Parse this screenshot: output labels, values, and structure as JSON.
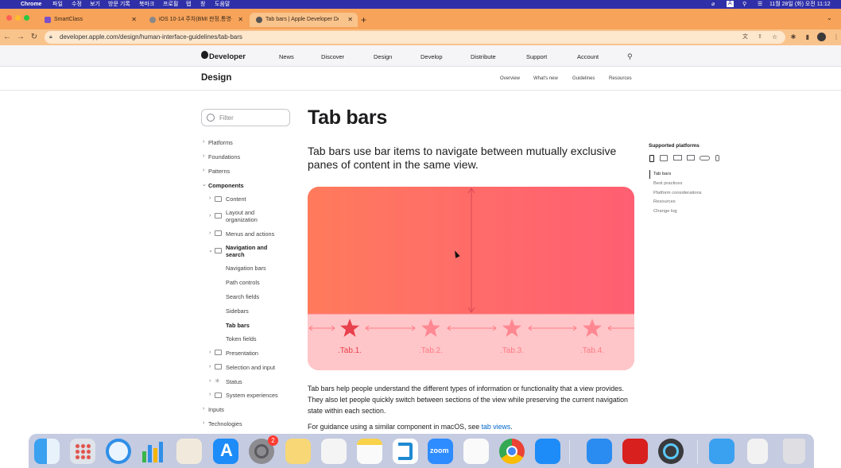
{
  "menubar": {
    "app": "Chrome",
    "items": [
      "파일",
      "수정",
      "보기",
      "방문 기록",
      "북마크",
      "프로필",
      "탭",
      "창",
      "도움말"
    ],
    "clock": "11월 28일 (화) 오전 11:12"
  },
  "browser": {
    "tabs": [
      {
        "title": "SmartClass",
        "active": false,
        "favicon_color": "#7b4fc8"
      },
      {
        "title": "iOS 10-14 주차(BMI 판정,통영신...",
        "active": false,
        "favicon_color": "#888888"
      },
      {
        "title": "Tab bars | Apple Developer Do...",
        "active": true,
        "favicon_color": "#555555"
      }
    ],
    "url": "developer.apple.com/design/human-interface-guidelines/tab-bars"
  },
  "globalnav": {
    "brand": "Developer",
    "items": [
      "News",
      "Discover",
      "Design",
      "Develop",
      "Distribute",
      "Support",
      "Account"
    ]
  },
  "localnav": {
    "title": "Design",
    "items": [
      "Overview",
      "What's new",
      "Guidelines",
      "Resources"
    ]
  },
  "sidebar": {
    "filter_placeholder": "Filter",
    "top_items": [
      "Platforms",
      "Foundations",
      "Patterns"
    ],
    "section": "Components",
    "components": [
      "Content",
      "Layout and organization",
      "Menus and actions",
      "Navigation and search"
    ],
    "nav_children": [
      "Navigation bars",
      "Path controls",
      "Search fields",
      "Sidebars",
      "Tab bars",
      "Token fields"
    ],
    "more_components": [
      "Presentation",
      "Selection and input",
      "Status",
      "System experiences"
    ],
    "bottom_items": [
      "Inputs",
      "Technologies"
    ]
  },
  "main": {
    "title": "Tab bars",
    "lede": "Tab bars use bar items to navigate between mutually exclusive panes of content in the same view.",
    "tab_labels": [
      ".Tab.1.",
      ".Tab.2.",
      ".Tab.3.",
      ".Tab.4."
    ],
    "body1": "Tab bars help people understand the different types of information or functionality that a view provides. They also let people quickly switch between sections of the view while preserving the current navigation state within each section.",
    "body2_prefix": "For guidance using a similar component in macOS, see ",
    "body2_link": "tab views",
    "body2_suffix": "."
  },
  "toc": {
    "heading": "Supported platforms",
    "items": [
      "Tab bars",
      "Best practices",
      "Platform considerations",
      "Resources",
      "Change log"
    ]
  },
  "dock": {
    "badge": "2",
    "zoom_label": "zoom",
    "apps": [
      "Finder",
      "Launchpad",
      "Safari",
      "Numbers",
      "TextEdit",
      "App Store",
      "System Preferences",
      "Notes",
      "Script Editor",
      "Notes Yellow",
      "VS Code",
      "Zoom",
      "Reminders",
      "Chrome",
      "Xcode",
      "App Store 2",
      "Acrobat",
      "QuickTime",
      "Folder",
      "Archive",
      "Trash"
    ]
  },
  "colors": {
    "accent": "#0066cc",
    "hero_star": "#e8404c",
    "hero_star_faint": "#ff8791"
  }
}
